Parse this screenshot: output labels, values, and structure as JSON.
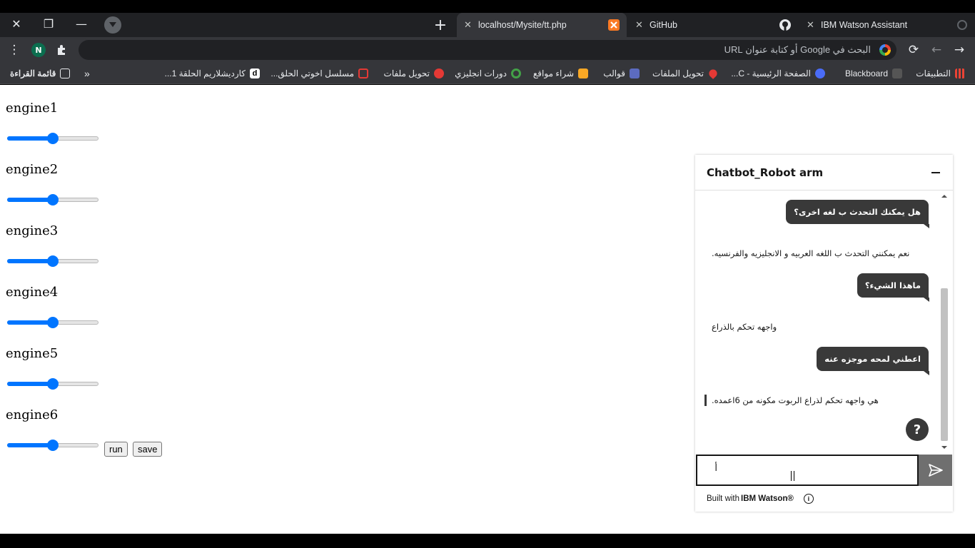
{
  "browser": {
    "tabs": [
      {
        "title": "localhost/Mysite/tt.php",
        "active": true
      },
      {
        "title": "GitHub",
        "active": false
      },
      {
        "title": "IBM Watson Assistant",
        "active": false
      }
    ],
    "profile_initial": "N",
    "omnibox_placeholder": "البحث في Google أو كتابة عنوان URL",
    "bookmarks": [
      {
        "label": "التطبيقات",
        "icon": "apps-grid-icon",
        "color": "#ea4335"
      },
      {
        "label": "Blackboard",
        "icon": "blackboard-icon",
        "color": "#444"
      },
      {
        "label": "الصفحة الرئيسية - C...",
        "icon": "c-logo-icon",
        "color": "#4a6cf7"
      },
      {
        "label": "تحويل الملفات",
        "icon": "heart-icon",
        "color": "#e53935"
      },
      {
        "label": "قوالب",
        "icon": "template-icon",
        "color": "#5c6bc0"
      },
      {
        "label": "شراء مواقع",
        "icon": "site-icon",
        "color": "#f9a825"
      },
      {
        "label": "دورات انجليزي",
        "icon": "circle-icon",
        "color": "#43a047"
      },
      {
        "label": "تحويل ملفات",
        "icon": "convert-icon",
        "color": "#e53935"
      },
      {
        "label": "مسلسل اخوتي الحلق...",
        "icon": "heart-outline-icon",
        "color": "#e53935"
      },
      {
        "label": "كارديشلاريم الحلقة 1...",
        "icon": "d-logo-icon",
        "color": "#fff"
      }
    ],
    "reading_list": "قائمة القراءة"
  },
  "page": {
    "engines": [
      {
        "label": "engine1",
        "value": 50
      },
      {
        "label": "engine2",
        "value": 50
      },
      {
        "label": "engine3",
        "value": 50
      },
      {
        "label": "engine4",
        "value": 50
      },
      {
        "label": "engine5",
        "value": 50
      },
      {
        "label": "engine6",
        "value": 50
      }
    ],
    "run_label": "run",
    "save_label": "save"
  },
  "chat": {
    "title": "Chatbot_Robot arm",
    "messages": [
      {
        "from": "user",
        "text": "هل يمكنك التحدث ب لغه اخرى؟"
      },
      {
        "from": "bot",
        "text": "نعم يمكنني التحدث ب اللغه العربيه و الانجليزيه والفرنسيه."
      },
      {
        "from": "user",
        "text": "ماهذا الشيء؟"
      },
      {
        "from": "bot",
        "text": "واجهه تحكم بالذراع"
      },
      {
        "from": "user",
        "text": "اعطني لمحه موجزه عنه"
      },
      {
        "from": "bot",
        "text": "هي واجهه تحكم لذراع الربوت مكونه من 6اعمده."
      }
    ],
    "help_label": "?",
    "input_value": "أ",
    "footer_prefix": "Built with ",
    "footer_brand": "IBM Watson®"
  }
}
